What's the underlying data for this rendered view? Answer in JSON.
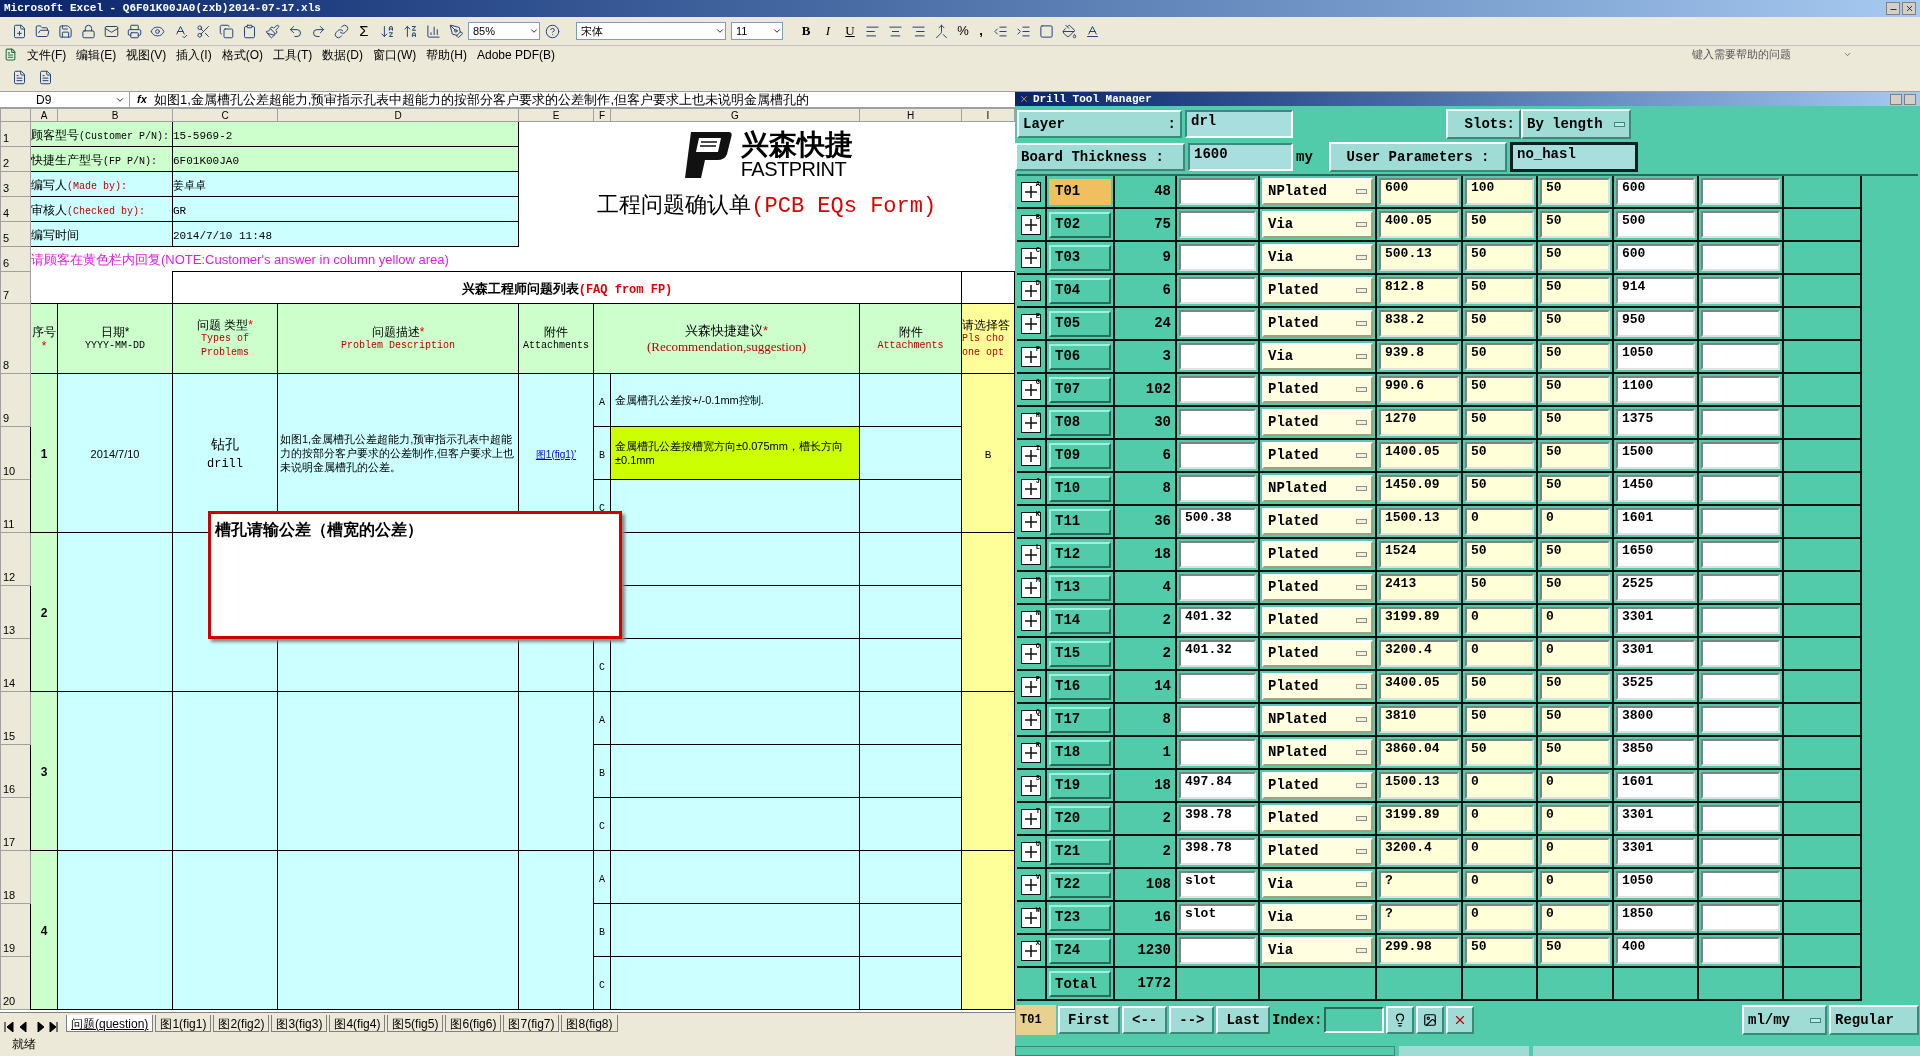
{
  "excel": {
    "title": "Microsoft Excel - Q6F01K00JA0(zxb)2014-07-17.xls",
    "font": "宋体",
    "font_size": "11",
    "zoom": "85%",
    "format_buttons": [
      "B",
      "I",
      "U"
    ],
    "sum": "Σ",
    "percent": "%",
    "comma": ",",
    "menu": [
      "文件(F)",
      "编辑(E)",
      "视图(V)",
      "插入(I)",
      "格式(O)",
      "工具(T)",
      "数据(D)",
      "窗口(W)",
      "帮助(H)",
      "Adobe PDF(B)"
    ],
    "help_placeholder": "键入需要帮助的问题",
    "name_box": "D9",
    "fx": "fx",
    "formula": "如图1,金属槽孔公差超能力,预审指示孔表中超能力的按部分客户要求的公差制作,但客户要求上也未说明金属槽孔的",
    "columns": [
      "A",
      "B",
      "C",
      "D",
      "E",
      "F",
      "G",
      "H",
      "I"
    ],
    "row_headers": [
      "1",
      "2",
      "3",
      "4",
      "5",
      "6",
      "7",
      "8",
      "9",
      "10",
      "11",
      "12",
      "13",
      "14",
      "15",
      "16",
      "17",
      "18",
      "19",
      "20"
    ],
    "info": [
      {
        "label": "顾客型号",
        "label_en": "(Customer P/N):",
        "en_red": false,
        "value": "15-5969-2",
        "color": "#ccffcc"
      },
      {
        "label": "快捷生产型号",
        "label_en": "(FP P/N):",
        "en_red": false,
        "value": "6F01K00JA0",
        "color": "#ccffcc"
      },
      {
        "label": "编写人",
        "label_en": "(Made by):",
        "en_red": true,
        "value": "姜卓卓",
        "color": "#ccffff"
      },
      {
        "label": "审核人",
        "label_en": "(Checked by):",
        "en_red": true,
        "value": "GR",
        "color": "#ccffff"
      },
      {
        "label": "编写时间",
        "value": "2014/7/10 11:48",
        "color": "#ccffff"
      }
    ],
    "logo": {
      "cn": "兴森快捷",
      "en": "FASTPRINT"
    },
    "form_title": {
      "cn": "工程问题确认单",
      "en": "(PCB EQs Form)"
    },
    "note": "请顾客在黄色栏内回复(NOTE:Customer's answer in column yellow area)",
    "list_title": {
      "cn": "兴森工程师问题列表",
      "en": "(FAQ from FP)"
    },
    "headers": [
      {
        "cn": "序号",
        "star": "*"
      },
      {
        "cn": "日期*",
        "en": [
          "YYYY-MM-DD"
        ],
        "en_red": false
      },
      {
        "cn": "问题 类型",
        "star": "*",
        "en": [
          "Types of",
          "Problems"
        ],
        "en_red": true
      },
      {
        "cn": "问题描述",
        "star": "*",
        "en": [
          "Problem Description"
        ],
        "en_red": true
      },
      {
        "cn": "附件",
        "en": [
          "Attachments"
        ],
        "en_red": false
      },
      {
        "cn": "兴森快捷建议",
        "star": "*",
        "en": [
          "(Recommendation,suggestion)"
        ],
        "en_red": true
      },
      {
        "cn": "附件",
        "en": [
          "Attachments"
        ],
        "en_red": true
      },
      {
        "cn": "请选择答",
        "en": [
          "Pls cho",
          "one opt"
        ],
        "en_red": true
      }
    ],
    "items": [
      {
        "no": "1",
        "date": "2014/7/10",
        "type_cn": "钻孔",
        "type_en": "drill",
        "desc": "如图1,金属槽孔公差超能力,预审指示孔表中超能力的按部分客户要求的公差制作,但客户要求上也未说明金属槽孔的公差。",
        "attachment": "图1(fig1)'",
        "answer": "B",
        "options": [
          {
            "letter": "A",
            "text": "金属槽孔公差按+/-0.1mm控制.",
            "highlighted": false
          },
          {
            "letter": "B",
            "text": "金属槽孔公差按槽宽方向±0.075mm，槽长方向±0.1mm",
            "highlighted": true
          },
          {
            "letter": "C",
            "highlighted": false
          }
        ]
      },
      {
        "no": "2",
        "options": [
          {
            "highlighted": false
          },
          {
            "highlighted": false
          },
          {
            "letter": "C",
            "highlighted": false
          }
        ]
      },
      {
        "no": "3",
        "options": [
          {
            "letter": "A",
            "highlighted": false
          },
          {
            "letter": "B",
            "highlighted": false
          },
          {
            "letter": "C",
            "highlighted": false
          }
        ]
      },
      {
        "no": "4",
        "options": [
          {
            "letter": "A",
            "highlighted": false
          },
          {
            "letter": "B",
            "highlighted": false
          },
          {
            "letter": "C",
            "highlighted": false
          }
        ]
      }
    ],
    "comment": "槽孔请输公差（槽宽的公差）",
    "sheet_tabs": [
      {
        "label": "问题(question)",
        "selected": true
      },
      {
        "label": "图1(fig1)",
        "selected": false
      },
      {
        "label": "图2(fig2)",
        "selected": false
      },
      {
        "label": "图3(fig3)",
        "selected": false
      },
      {
        "label": "图4(fig4)",
        "selected": false
      },
      {
        "label": "图5(fig5)",
        "selected": false
      },
      {
        "label": "图6(fig6)",
        "selected": false
      },
      {
        "label": "图7(fig7)",
        "selected": false
      },
      {
        "label": "图8(fig8)",
        "selected": false
      }
    ],
    "status": "就绪"
  },
  "drill": {
    "title": "Drill Tool Manager",
    "layer_label": [
      "Layer",
      ":"
    ],
    "layer": "drl",
    "slots_label": "Slots:",
    "slots": "By length",
    "thickness_label": "Board Thickness :",
    "thickness": "1600",
    "unit": "my",
    "params_label": "User Parameters :",
    "params": "no_hasl",
    "tools": [
      {
        "letter": "A",
        "name": "T01",
        "selected": true,
        "count": "48",
        "type": "NPlated",
        "field_2": "600",
        "field_3": "100",
        "field_4": "50",
        "field_5": "600"
      },
      {
        "letter": "B",
        "name": "T02",
        "selected": false,
        "count": "75",
        "type": "Via",
        "field_2": "400.05",
        "field_3": "50",
        "field_4": "50",
        "field_5": "500"
      },
      {
        "letter": "C",
        "name": "T03",
        "selected": false,
        "count": "9",
        "type": "Via",
        "field_2": "500.13",
        "field_3": "50",
        "field_4": "50",
        "field_5": "600"
      },
      {
        "letter": "D",
        "name": "T04",
        "selected": false,
        "count": "6",
        "type": "Plated",
        "field_2": "812.8",
        "field_3": "50",
        "field_4": "50",
        "field_5": "914"
      },
      {
        "letter": "E",
        "name": "T05",
        "selected": false,
        "count": "24",
        "type": "Plated",
        "field_2": "838.2",
        "field_3": "50",
        "field_4": "50",
        "field_5": "950"
      },
      {
        "letter": "F",
        "name": "T06",
        "selected": false,
        "count": "3",
        "type": "Via",
        "field_2": "939.8",
        "field_3": "50",
        "field_4": "50",
        "field_5": "1050"
      },
      {
        "letter": "G",
        "name": "T07",
        "selected": false,
        "count": "102",
        "type": "Plated",
        "field_2": "990.6",
        "field_3": "50",
        "field_4": "50",
        "field_5": "1100"
      },
      {
        "letter": "H",
        "name": "T08",
        "selected": false,
        "count": "30",
        "type": "Plated",
        "field_2": "1270",
        "field_3": "50",
        "field_4": "50",
        "field_5": "1375"
      },
      {
        "letter": "I",
        "name": "T09",
        "selected": false,
        "count": "6",
        "type": "Plated",
        "field_2": "1400.05",
        "field_3": "50",
        "field_4": "50",
        "field_5": "1500"
      },
      {
        "letter": "J",
        "name": "T10",
        "selected": false,
        "count": "8",
        "type": "NPlated",
        "field_2": "1450.09",
        "field_3": "50",
        "field_4": "50",
        "field_5": "1450"
      },
      {
        "letter": "K",
        "name": "T11",
        "selected": false,
        "count": "36",
        "field_1": "500.38",
        "type": "Plated",
        "field_2": "1500.13",
        "field_3": "0",
        "field_4": "0",
        "field_5": "1601"
      },
      {
        "letter": "L",
        "name": "T12",
        "selected": false,
        "count": "18",
        "type": "Plated",
        "field_2": "1524",
        "field_3": "50",
        "field_4": "50",
        "field_5": "1650"
      },
      {
        "letter": "M",
        "name": "T13",
        "selected": false,
        "count": "4",
        "type": "Plated",
        "field_2": "2413",
        "field_3": "50",
        "field_4": "50",
        "field_5": "2525"
      },
      {
        "letter": "N",
        "name": "T14",
        "selected": false,
        "count": "2",
        "field_1": "401.32",
        "type": "Plated",
        "field_2": "3199.89",
        "field_3": "0",
        "field_4": "0",
        "field_5": "3301"
      },
      {
        "letter": "O",
        "name": "T15",
        "selected": false,
        "count": "2",
        "field_1": "401.32",
        "type": "Plated",
        "field_2": "3200.4",
        "field_3": "0",
        "field_4": "0",
        "field_5": "3301"
      },
      {
        "letter": "P",
        "name": "T16",
        "selected": false,
        "count": "14",
        "type": "Plated",
        "field_2": "3400.05",
        "field_3": "50",
        "field_4": "50",
        "field_5": "3525"
      },
      {
        "letter": "Q",
        "name": "T17",
        "selected": false,
        "count": "8",
        "type": "NPlated",
        "field_2": "3810",
        "field_3": "50",
        "field_4": "50",
        "field_5": "3800"
      },
      {
        "letter": "R",
        "name": "T18",
        "selected": false,
        "count": "1",
        "type": "NPlated",
        "field_2": "3860.04",
        "field_3": "50",
        "field_4": "50",
        "field_5": "3850"
      },
      {
        "letter": "S",
        "name": "T19",
        "selected": false,
        "count": "18",
        "field_1": "497.84",
        "type": "Plated",
        "field_2": "1500.13",
        "field_3": "0",
        "field_4": "0",
        "field_5": "1601"
      },
      {
        "letter": "T",
        "name": "T20",
        "selected": false,
        "count": "2",
        "field_1": "398.78",
        "type": "Plated",
        "field_2": "3199.89",
        "field_3": "0",
        "field_4": "0",
        "field_5": "3301"
      },
      {
        "letter": "U",
        "name": "T21",
        "selected": false,
        "count": "2",
        "field_1": "398.78",
        "type": "Plated",
        "field_2": "3200.4",
        "field_3": "0",
        "field_4": "0",
        "field_5": "3301"
      },
      {
        "letter": "V",
        "name": "T22",
        "selected": false,
        "count": "108",
        "field_1": "slot",
        "type": "Via",
        "field_2": "?",
        "field_3": "0",
        "field_4": "0",
        "field_5": "1050"
      },
      {
        "letter": "W",
        "name": "T23",
        "selected": false,
        "count": "16",
        "field_1": "slot",
        "type": "Via",
        "field_2": "?",
        "field_3": "0",
        "field_4": "0",
        "field_5": "1850"
      },
      {
        "letter": "X",
        "name": "T24",
        "selected": false,
        "count": "1230",
        "type": "Via",
        "field_2": "299.98",
        "field_3": "50",
        "field_4": "50",
        "field_5": "400"
      }
    ],
    "total_label": "Total",
    "total": "1772",
    "nav": {
      "current": "T01",
      "buttons": [
        "First",
        "<--",
        "-->",
        "Last"
      ],
      "index_label": "Index:",
      "units": "ml/my",
      "mode": "Regular"
    }
  }
}
